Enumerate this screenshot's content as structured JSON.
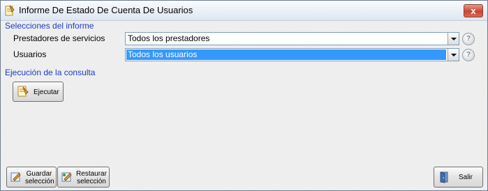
{
  "window": {
    "title": "Informe De Estado De Cuenta De Usuarios",
    "close_label": "x"
  },
  "selecciones": {
    "heading": "Selecciones del informe",
    "prestadores": {
      "label": "Prestadores de servicios",
      "value": "Todos los prestadores"
    },
    "usuarios": {
      "label": "Usuarios",
      "value": "Todos los usuarios"
    }
  },
  "ejecucion": {
    "heading": "Ejecución de la consulta",
    "ejecutar_label": "Ejecutar"
  },
  "footer": {
    "guardar_line1": "Guardar",
    "guardar_line2": "selección",
    "restaurar_line1": "Restaurar",
    "restaurar_line2": "selección",
    "salir_label": "Salir"
  },
  "help_glyph": "?"
}
